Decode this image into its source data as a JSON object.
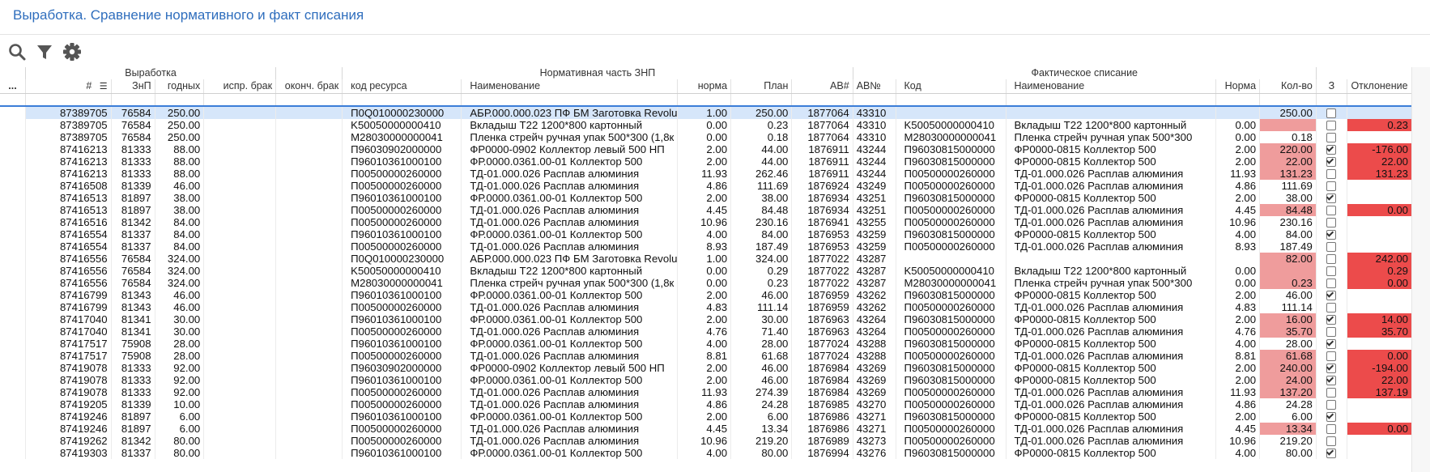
{
  "page": {
    "title": "Выработка. Сравнение нормативного и факт списания"
  },
  "colors": {
    "accent": "#2f6ebd",
    "selection": "#d6e6fa",
    "pink": "#ef9c9c",
    "red": "#ec4b4b"
  },
  "toolbar": {
    "icons": [
      "search-icon",
      "filter-icon",
      "gear-icon"
    ]
  },
  "grid": {
    "menu_label": "...",
    "groups": {
      "output": "Выработка",
      "normative": "Нормативная часть ЗНП",
      "fact": "Фактическое списание"
    },
    "columns": [
      "#",
      "ЗнП",
      "годных",
      "испр. брак",
      "оконч. брак",
      "код ресурса",
      "Наименование",
      "норма",
      "План",
      "АВ#",
      "АВ№",
      "Код",
      "Наименование",
      "Норма",
      "Кол-во",
      "З",
      "Отклонение"
    ],
    "rows": [
      [
        "87389705",
        "76584",
        "250.00",
        "",
        "",
        "П0Q010000230000",
        "АБР.000.000.023 ПФ БМ Заготовка Revolu",
        "1.00",
        "250.00",
        "1877064",
        "43310",
        "",
        "",
        "",
        "250.00",
        false,
        ""
      ],
      [
        "87389705",
        "76584",
        "250.00",
        "",
        "",
        "K50050000000410",
        " Вкладыш Т22 1200*800 картонный",
        "0.00",
        "0.23",
        "1877064",
        "43310",
        "K50050000000410",
        " Вкладыш Т22 1200*800 картонный",
        "0.00",
        "",
        false,
        "0.23"
      ],
      [
        "87389705",
        "76584",
        "250.00",
        "",
        "",
        "M28030000000041",
        "Пленка стрейч ручная упак 500*300 (1,8к",
        "0.00",
        "0.18",
        "1877064",
        "43310",
        "M28030000000041",
        "Пленка стрейч ручная упак 500*300",
        "0.00",
        "0.18",
        false,
        ""
      ],
      [
        "87416213",
        "81333",
        "88.00",
        "",
        "",
        "П96030902000000",
        "ФР0000-0902 Коллектор левый 500 НП",
        "2.00",
        "44.00",
        "1876911",
        "43244",
        "П96030815000000",
        "ФР0000-0815 Коллектор 500",
        "2.00",
        "220.00",
        true,
        "-176.00"
      ],
      [
        "87416213",
        "81333",
        "88.00",
        "",
        "",
        "П96010361000100",
        "ФР.0000.0361.00-01 Коллектор 500",
        "2.00",
        "44.00",
        "1876911",
        "43244",
        "П96030815000000",
        "ФР0000-0815 Коллектор 500",
        "2.00",
        "22.00",
        true,
        "22.00"
      ],
      [
        "87416213",
        "81333",
        "88.00",
        "",
        "",
        "П00500000260000",
        "ТД-01.000.026 Расплав алюминия",
        "11.93",
        "262.46",
        "1876911",
        "43244",
        "П00500000260000",
        "ТД-01.000.026 Расплав алюминия",
        "11.93",
        "131.23",
        false,
        "131.23"
      ],
      [
        "87416508",
        "81339",
        "46.00",
        "",
        "",
        "П00500000260000",
        "ТД-01.000.026 Расплав алюминия",
        "4.86",
        "111.69",
        "1876924",
        "43249",
        "П00500000260000",
        "ТД-01.000.026 Расплав алюминия",
        "4.86",
        "111.69",
        false,
        ""
      ],
      [
        "87416513",
        "81897",
        "38.00",
        "",
        "",
        "П96010361000100",
        "ФР.0000.0361.00-01 Коллектор 500",
        "2.00",
        "38.00",
        "1876934",
        "43251",
        "П96030815000000",
        "ФР0000-0815 Коллектор 500",
        "2.00",
        "38.00",
        true,
        ""
      ],
      [
        "87416513",
        "81897",
        "38.00",
        "",
        "",
        "П00500000260000",
        "ТД-01.000.026 Расплав алюминия",
        "4.45",
        "84.48",
        "1876934",
        "43251",
        "П00500000260000",
        "ТД-01.000.026 Расплав алюминия",
        "4.45",
        "84.48",
        false,
        "0.00"
      ],
      [
        "87416516",
        "81342",
        "84.00",
        "",
        "",
        "П00500000260000",
        "ТД-01.000.026 Расплав алюминия",
        "10.96",
        "230.16",
        "1876941",
        "43255",
        "П00500000260000",
        "ТД-01.000.026 Расплав алюминия",
        "10.96",
        "230.16",
        false,
        ""
      ],
      [
        "87416554",
        "81337",
        "84.00",
        "",
        "",
        "П96010361000100",
        "ФР.0000.0361.00-01 Коллектор 500",
        "4.00",
        "84.00",
        "1876953",
        "43259",
        "П96030815000000",
        "ФР0000-0815 Коллектор 500",
        "4.00",
        "84.00",
        true,
        ""
      ],
      [
        "87416554",
        "81337",
        "84.00",
        "",
        "",
        "П00500000260000",
        "ТД-01.000.026 Расплав алюминия",
        "8.93",
        "187.49",
        "1876953",
        "43259",
        "П00500000260000",
        "ТД-01.000.026 Расплав алюминия",
        "8.93",
        "187.49",
        false,
        ""
      ],
      [
        "87416556",
        "76584",
        "324.00",
        "",
        "",
        "П0Q010000230000",
        "АБР.000.000.023 ПФ БМ Заготовка Revolu",
        "1.00",
        "324.00",
        "1877022",
        "43287",
        "",
        "",
        "",
        "82.00",
        false,
        "242.00"
      ],
      [
        "87416556",
        "76584",
        "324.00",
        "",
        "",
        "K50050000000410",
        " Вкладыш Т22 1200*800 картонный",
        "0.00",
        "0.29",
        "1877022",
        "43287",
        "K50050000000410",
        " Вкладыш Т22 1200*800 картонный",
        "0.00",
        "",
        false,
        "0.29"
      ],
      [
        "87416556",
        "76584",
        "324.00",
        "",
        "",
        "M28030000000041",
        "Пленка стрейч ручная упак 500*300 (1,8к",
        "0.00",
        "0.23",
        "1877022",
        "43287",
        "M28030000000041",
        "Пленка стрейч ручная упак 500*300",
        "0.00",
        "0.23",
        false,
        "0.00"
      ],
      [
        "87416799",
        "81343",
        "46.00",
        "",
        "",
        "П96010361000100",
        "ФР.0000.0361.00-01 Коллектор 500",
        "2.00",
        "46.00",
        "1876959",
        "43262",
        "П96030815000000",
        "ФР0000-0815 Коллектор 500",
        "2.00",
        "46.00",
        true,
        ""
      ],
      [
        "87416799",
        "81343",
        "46.00",
        "",
        "",
        "П00500000260000",
        "ТД-01.000.026 Расплав алюминия",
        "4.83",
        "111.14",
        "1876959",
        "43262",
        "П00500000260000",
        "ТД-01.000.026 Расплав алюминия",
        "4.83",
        "111.14",
        false,
        ""
      ],
      [
        "87417040",
        "81341",
        "30.00",
        "",
        "",
        "П96010361000100",
        "ФР.0000.0361.00-01 Коллектор 500",
        "2.00",
        "30.00",
        "1876963",
        "43264",
        "П96030815000000",
        "ФР0000-0815 Коллектор 500",
        "2.00",
        "16.00",
        true,
        "14.00"
      ],
      [
        "87417040",
        "81341",
        "30.00",
        "",
        "",
        "П00500000260000",
        "ТД-01.000.026 Расплав алюминия",
        "4.76",
        "71.40",
        "1876963",
        "43264",
        "П00500000260000",
        "ТД-01.000.026 Расплав алюминия",
        "4.76",
        "35.70",
        false,
        "35.70"
      ],
      [
        "87417517",
        "75908",
        "28.00",
        "",
        "",
        "П96010361000100",
        "ФР.0000.0361.00-01 Коллектор 500",
        "4.00",
        "28.00",
        "1877024",
        "43288",
        "П96030815000000",
        "ФР0000-0815 Коллектор 500",
        "4.00",
        "28.00",
        true,
        ""
      ],
      [
        "87417517",
        "75908",
        "28.00",
        "",
        "",
        "П00500000260000",
        "ТД-01.000.026 Расплав алюминия",
        "8.81",
        "61.68",
        "1877024",
        "43288",
        "П00500000260000",
        "ТД-01.000.026 Расплав алюминия",
        "8.81",
        "61.68",
        false,
        "0.00"
      ],
      [
        "87419078",
        "81333",
        "92.00",
        "",
        "",
        "П96030902000000",
        "ФР0000-0902 Коллектор левый 500 НП",
        "2.00",
        "46.00",
        "1876984",
        "43269",
        "П96030815000000",
        "ФР0000-0815 Коллектор 500",
        "2.00",
        "240.00",
        true,
        "-194.00"
      ],
      [
        "87419078",
        "81333",
        "92.00",
        "",
        "",
        "П96010361000100",
        "ФР.0000.0361.00-01 Коллектор 500",
        "2.00",
        "46.00",
        "1876984",
        "43269",
        "П96030815000000",
        "ФР0000-0815 Коллектор 500",
        "2.00",
        "24.00",
        true,
        "22.00"
      ],
      [
        "87419078",
        "81333",
        "92.00",
        "",
        "",
        "П00500000260000",
        "ТД-01.000.026 Расплав алюминия",
        "11.93",
        "274.39",
        "1876984",
        "43269",
        "П00500000260000",
        "ТД-01.000.026 Расплав алюминия",
        "11.93",
        "137.20",
        false,
        "137.19"
      ],
      [
        "87419205",
        "81339",
        "10.00",
        "",
        "",
        "П00500000260000",
        "ТД-01.000.026 Расплав алюминия",
        "4.86",
        "24.28",
        "1876985",
        "43270",
        "П00500000260000",
        "ТД-01.000.026 Расплав алюминия",
        "4.86",
        "24.28",
        false,
        ""
      ],
      [
        "87419246",
        "81897",
        "6.00",
        "",
        "",
        "П96010361000100",
        "ФР.0000.0361.00-01 Коллектор 500",
        "2.00",
        "6.00",
        "1876986",
        "43271",
        "П96030815000000",
        "ФР0000-0815 Коллектор 500",
        "2.00",
        "6.00",
        true,
        ""
      ],
      [
        "87419246",
        "81897",
        "6.00",
        "",
        "",
        "П00500000260000",
        "ТД-01.000.026 Расплав алюминия",
        "4.45",
        "13.34",
        "1876986",
        "43271",
        "П00500000260000",
        "ТД-01.000.026 Расплав алюминия",
        "4.45",
        "13.34",
        false,
        "0.00"
      ],
      [
        "87419262",
        "81342",
        "80.00",
        "",
        "",
        "П00500000260000",
        "ТД-01.000.026 Расплав алюминия",
        "10.96",
        "219.20",
        "1876989",
        "43273",
        "П00500000260000",
        "ТД-01.000.026 Расплав алюминия",
        "10.96",
        "219.20",
        false,
        ""
      ],
      [
        "87419303",
        "81337",
        "80.00",
        "",
        "",
        "П96010361000100",
        "ФР.0000.0361.00-01 Коллектор 500",
        "4.00",
        "80.00",
        "1876994",
        "43276",
        "П96030815000000",
        "ФР0000-0815 Коллектор 500",
        "4.00",
        "80.00",
        true,
        ""
      ]
    ],
    "highlight": {
      "qty_pink_rows": [
        1,
        3,
        4,
        5,
        8,
        12,
        13,
        14,
        17,
        18,
        20,
        21,
        22,
        23,
        26
      ],
      "dev_red_rows": [
        1,
        3,
        4,
        5,
        8,
        12,
        13,
        14,
        17,
        18,
        20,
        21,
        22,
        23,
        26
      ]
    }
  }
}
